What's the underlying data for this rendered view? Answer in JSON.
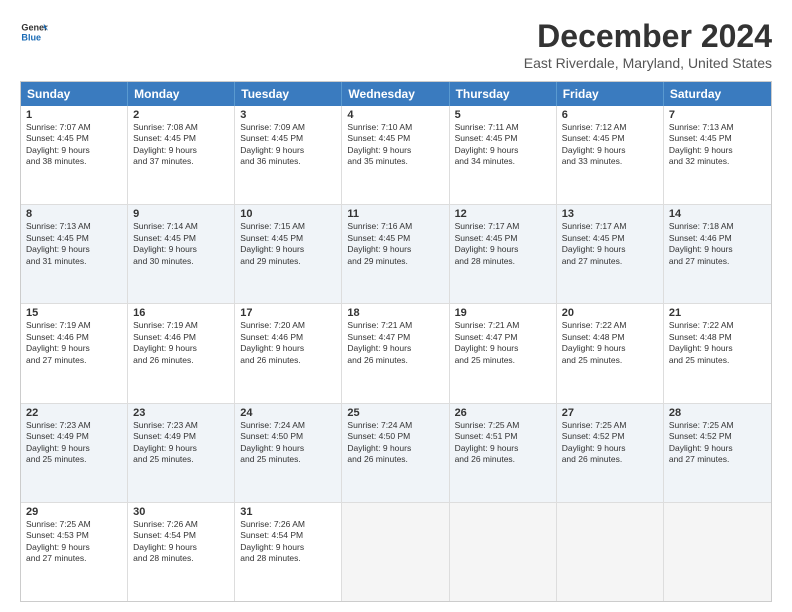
{
  "header": {
    "logo_line1": "General",
    "logo_line2": "Blue",
    "title": "December 2024",
    "subtitle": "East Riverdale, Maryland, United States"
  },
  "weekdays": [
    "Sunday",
    "Monday",
    "Tuesday",
    "Wednesday",
    "Thursday",
    "Friday",
    "Saturday"
  ],
  "rows": [
    [
      {
        "day": "1",
        "text": "Sunrise: 7:07 AM\nSunset: 4:45 PM\nDaylight: 9 hours\nand 38 minutes."
      },
      {
        "day": "2",
        "text": "Sunrise: 7:08 AM\nSunset: 4:45 PM\nDaylight: 9 hours\nand 37 minutes."
      },
      {
        "day": "3",
        "text": "Sunrise: 7:09 AM\nSunset: 4:45 PM\nDaylight: 9 hours\nand 36 minutes."
      },
      {
        "day": "4",
        "text": "Sunrise: 7:10 AM\nSunset: 4:45 PM\nDaylight: 9 hours\nand 35 minutes."
      },
      {
        "day": "5",
        "text": "Sunrise: 7:11 AM\nSunset: 4:45 PM\nDaylight: 9 hours\nand 34 minutes."
      },
      {
        "day": "6",
        "text": "Sunrise: 7:12 AM\nSunset: 4:45 PM\nDaylight: 9 hours\nand 33 minutes."
      },
      {
        "day": "7",
        "text": "Sunrise: 7:13 AM\nSunset: 4:45 PM\nDaylight: 9 hours\nand 32 minutes."
      }
    ],
    [
      {
        "day": "8",
        "text": "Sunrise: 7:13 AM\nSunset: 4:45 PM\nDaylight: 9 hours\nand 31 minutes."
      },
      {
        "day": "9",
        "text": "Sunrise: 7:14 AM\nSunset: 4:45 PM\nDaylight: 9 hours\nand 30 minutes."
      },
      {
        "day": "10",
        "text": "Sunrise: 7:15 AM\nSunset: 4:45 PM\nDaylight: 9 hours\nand 29 minutes."
      },
      {
        "day": "11",
        "text": "Sunrise: 7:16 AM\nSunset: 4:45 PM\nDaylight: 9 hours\nand 29 minutes."
      },
      {
        "day": "12",
        "text": "Sunrise: 7:17 AM\nSunset: 4:45 PM\nDaylight: 9 hours\nand 28 minutes."
      },
      {
        "day": "13",
        "text": "Sunrise: 7:17 AM\nSunset: 4:45 PM\nDaylight: 9 hours\nand 27 minutes."
      },
      {
        "day": "14",
        "text": "Sunrise: 7:18 AM\nSunset: 4:46 PM\nDaylight: 9 hours\nand 27 minutes."
      }
    ],
    [
      {
        "day": "15",
        "text": "Sunrise: 7:19 AM\nSunset: 4:46 PM\nDaylight: 9 hours\nand 27 minutes."
      },
      {
        "day": "16",
        "text": "Sunrise: 7:19 AM\nSunset: 4:46 PM\nDaylight: 9 hours\nand 26 minutes."
      },
      {
        "day": "17",
        "text": "Sunrise: 7:20 AM\nSunset: 4:46 PM\nDaylight: 9 hours\nand 26 minutes."
      },
      {
        "day": "18",
        "text": "Sunrise: 7:21 AM\nSunset: 4:47 PM\nDaylight: 9 hours\nand 26 minutes."
      },
      {
        "day": "19",
        "text": "Sunrise: 7:21 AM\nSunset: 4:47 PM\nDaylight: 9 hours\nand 25 minutes."
      },
      {
        "day": "20",
        "text": "Sunrise: 7:22 AM\nSunset: 4:48 PM\nDaylight: 9 hours\nand 25 minutes."
      },
      {
        "day": "21",
        "text": "Sunrise: 7:22 AM\nSunset: 4:48 PM\nDaylight: 9 hours\nand 25 minutes."
      }
    ],
    [
      {
        "day": "22",
        "text": "Sunrise: 7:23 AM\nSunset: 4:49 PM\nDaylight: 9 hours\nand 25 minutes."
      },
      {
        "day": "23",
        "text": "Sunrise: 7:23 AM\nSunset: 4:49 PM\nDaylight: 9 hours\nand 25 minutes."
      },
      {
        "day": "24",
        "text": "Sunrise: 7:24 AM\nSunset: 4:50 PM\nDaylight: 9 hours\nand 25 minutes."
      },
      {
        "day": "25",
        "text": "Sunrise: 7:24 AM\nSunset: 4:50 PM\nDaylight: 9 hours\nand 26 minutes."
      },
      {
        "day": "26",
        "text": "Sunrise: 7:25 AM\nSunset: 4:51 PM\nDaylight: 9 hours\nand 26 minutes."
      },
      {
        "day": "27",
        "text": "Sunrise: 7:25 AM\nSunset: 4:52 PM\nDaylight: 9 hours\nand 26 minutes."
      },
      {
        "day": "28",
        "text": "Sunrise: 7:25 AM\nSunset: 4:52 PM\nDaylight: 9 hours\nand 27 minutes."
      }
    ],
    [
      {
        "day": "29",
        "text": "Sunrise: 7:25 AM\nSunset: 4:53 PM\nDaylight: 9 hours\nand 27 minutes."
      },
      {
        "day": "30",
        "text": "Sunrise: 7:26 AM\nSunset: 4:54 PM\nDaylight: 9 hours\nand 28 minutes."
      },
      {
        "day": "31",
        "text": "Sunrise: 7:26 AM\nSunset: 4:54 PM\nDaylight: 9 hours\nand 28 minutes."
      },
      {
        "day": "",
        "text": ""
      },
      {
        "day": "",
        "text": ""
      },
      {
        "day": "",
        "text": ""
      },
      {
        "day": "",
        "text": ""
      }
    ]
  ]
}
